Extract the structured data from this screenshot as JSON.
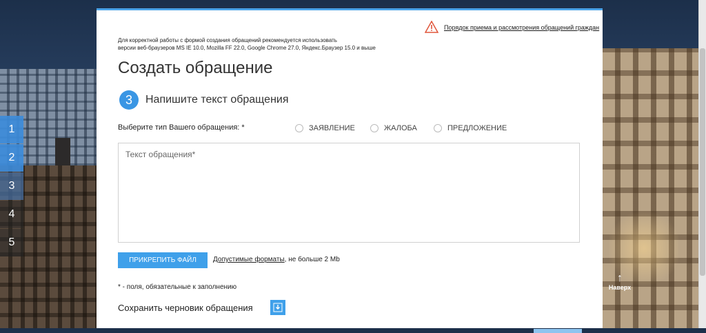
{
  "steps": [
    "1",
    "2",
    "3",
    "4",
    "5"
  ],
  "header": {
    "rules_link": "Порядок приема и рассмотрения обращений граждан",
    "browser_note_line1": "Для корректной работы с формой создания обращений рекомендуется использовать",
    "browser_note_line2": "версии веб-браузеров MS IE 10.0, Mozilla FF 22.0, Google Chrome 27.0, Яндекс.Браузер 15.0 и выше"
  },
  "page_title": "Создать обращение",
  "step": {
    "number": "3",
    "title": "Напишите текст обращения"
  },
  "type_select": {
    "label": "Выберите тип Вашего обращения: *",
    "options": [
      "ЗАЯВЛЕНИЕ",
      "ЖАЛОБА",
      "ПРЕДЛОЖЕНИЕ"
    ]
  },
  "message": {
    "placeholder": "Текст обращения*"
  },
  "attach": {
    "button": "ПРИКРЕПИТЬ ФАЙЛ",
    "formats_link": "Допустимые форматы",
    "formats_rest": ", не больше 2 Mb"
  },
  "required_note": "* - поля, обязательные к заполнению",
  "save_draft": "Сохранить черновик обращения",
  "to_top": {
    "label": "Наверх"
  },
  "colors": {
    "accent": "#3fa0ea",
    "step_circle": "#3a96e4",
    "warning": "#e0553a"
  }
}
